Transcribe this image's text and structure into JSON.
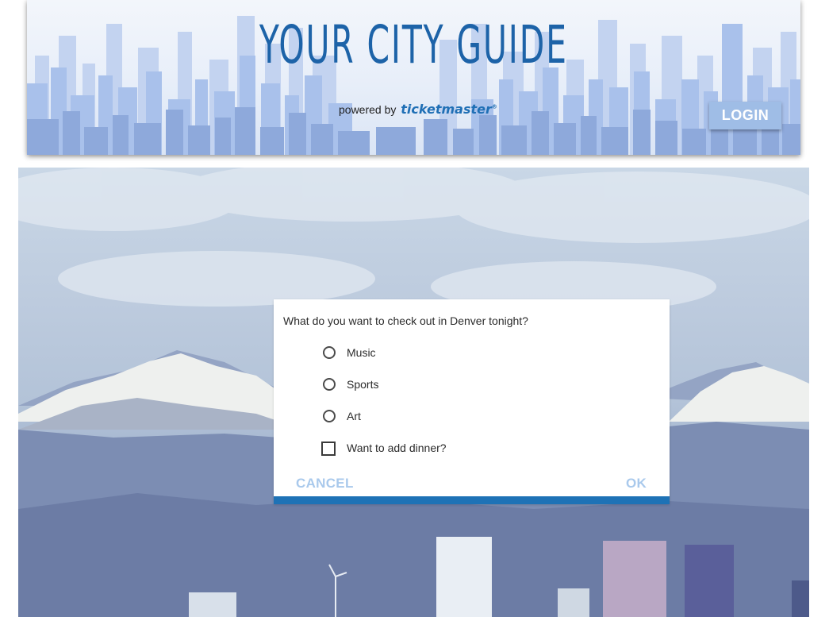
{
  "header": {
    "title": "YOUR CITY GUIDE",
    "powered_by": "powered by",
    "brand": "ticketmaster",
    "brand_mark": "®",
    "login_label": "LOGIN"
  },
  "dialog": {
    "question": "What do you want to check out in Denver tonight?",
    "options": [
      {
        "label": "Music",
        "type": "radio",
        "selected": false
      },
      {
        "label": "Sports",
        "type": "radio",
        "selected": false
      },
      {
        "label": "Art",
        "type": "radio",
        "selected": false
      }
    ],
    "dinner": {
      "label": "Want to add dinner?",
      "type": "checkbox",
      "checked": false
    },
    "cancel_label": "CANCEL",
    "ok_label": "OK"
  },
  "colors": {
    "title_blue": "#1d63a8",
    "login_bg": "#9fbde6",
    "dialog_accent": "#1e72b6",
    "dialog_button_text": "#a9c9ec"
  },
  "icons": {
    "skyline": "city-skyline-illustration",
    "hero": "denver-mountains-photo"
  }
}
